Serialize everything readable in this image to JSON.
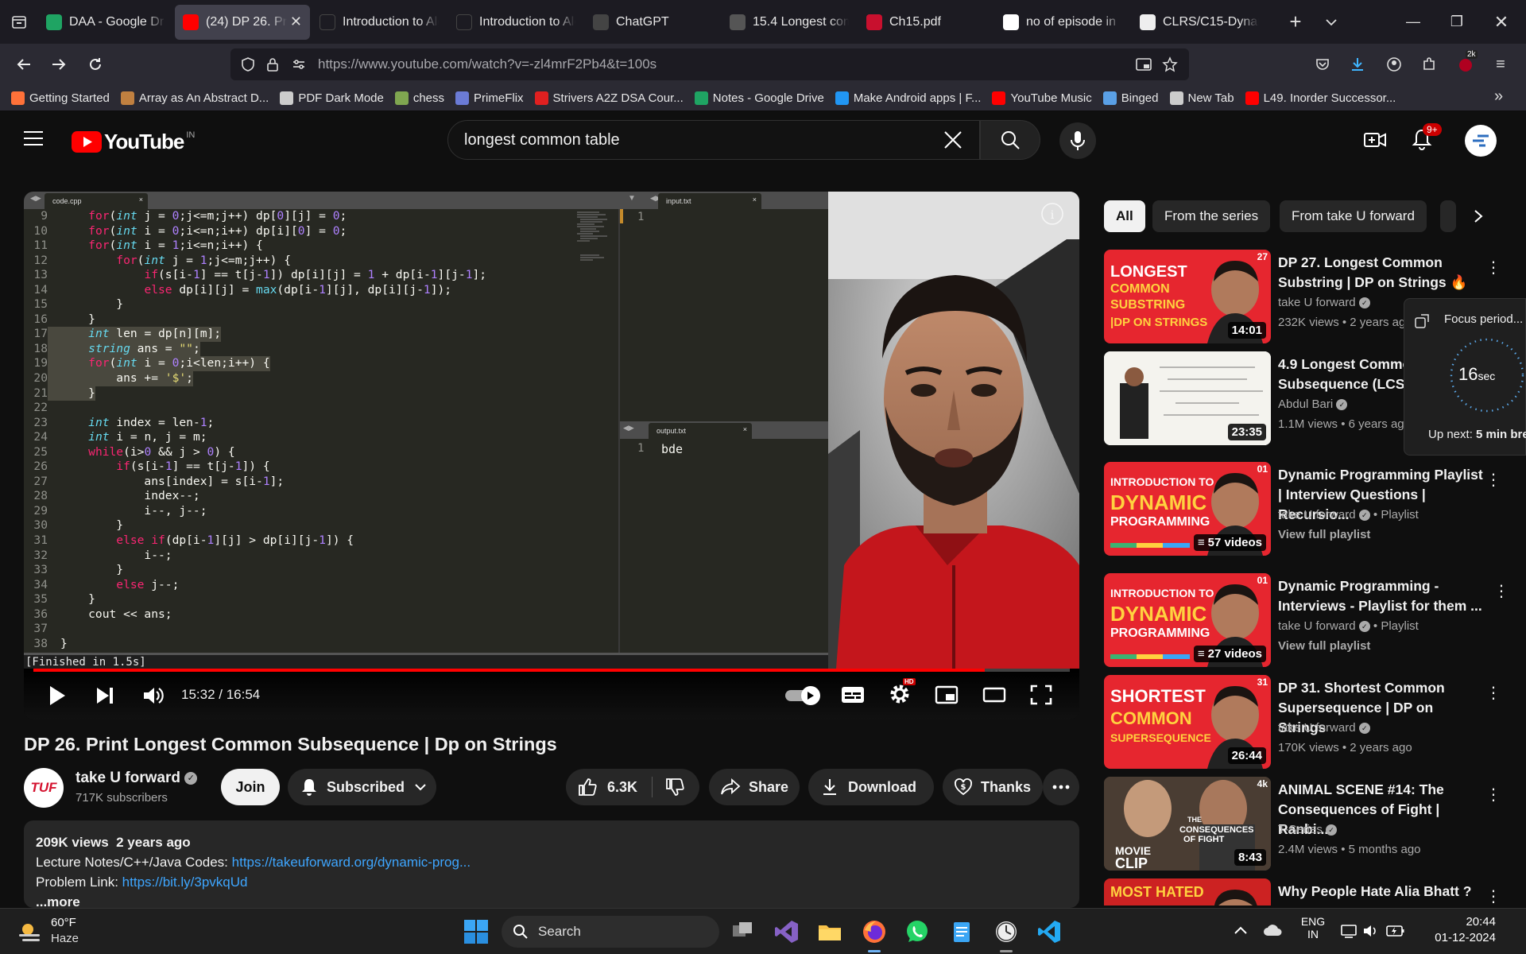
{
  "browser": {
    "tabs": [
      {
        "title": "DAA - Google Dr",
        "fav_color": "#1fa463"
      },
      {
        "title": "(24) DP 26. Print",
        "fav_color": "#ff0000",
        "active": true
      },
      {
        "title": "Introduction to Algor",
        "fav_color": "#1c1b22"
      },
      {
        "title": "Introduction to Algor",
        "fav_color": "#1c1b22"
      },
      {
        "title": "ChatGPT",
        "fav_color": "#444"
      },
      {
        "title": "15.4 Longest com",
        "fav_color": "#555"
      },
      {
        "title": "Ch15.pdf",
        "fav_color": "#c8102e"
      },
      {
        "title": "no of episode in",
        "fav_color": "#fff"
      },
      {
        "title": "CLRS/C15-Dynam",
        "fav_color": "#eee"
      }
    ],
    "url": "https://www.youtube.com/watch?v=-zl4mrF2Pb4&t=100s",
    "extension_badge": "2k",
    "bookmarks": [
      {
        "label": "Getting Started",
        "color": "#ff7139"
      },
      {
        "label": "Array as An Abstract D...",
        "color": "#c08040"
      },
      {
        "label": "PDF Dark Mode",
        "color": "#ccc"
      },
      {
        "label": "chess",
        "color": "#7fa650"
      },
      {
        "label": "PrimeFlix",
        "color": "#6b7bd6"
      },
      {
        "label": "Strivers A2Z DSA Cour...",
        "color": "#e02020"
      },
      {
        "label": "Notes - Google Drive",
        "color": "#1fa463"
      },
      {
        "label": "Make Android apps | F...",
        "color": "#2196f3"
      },
      {
        "label": "YouTube Music",
        "color": "#ff0000"
      },
      {
        "label": "Binged",
        "color": "#5aa0e6"
      },
      {
        "label": "New Tab",
        "color": "#ccc"
      },
      {
        "label": "L49. Inorder Successor...",
        "color": "#ff0000"
      }
    ]
  },
  "youtube": {
    "logo_text": "YouTube",
    "region": "IN",
    "search_value": "longest common table",
    "notification_count": "9+"
  },
  "player": {
    "editor_tabs": {
      "code": "code.cpp",
      "input": "input.txt",
      "output": "output.txt"
    },
    "input_line": "1",
    "output_line": "1",
    "output_text": "bde",
    "console_text": "[Finished in 1.5s]",
    "time": "15:32 / 16:54",
    "progress": 0.918,
    "code_start_line": 9,
    "code_lines": [
      "    for(int j = 0;j<=m;j++) dp[0][j] = 0;",
      "    for(int i = 0;i<=n;i++) dp[i][0] = 0;",
      "    for(int i = 1;i<=n;i++) {",
      "        for(int j = 1;j<=m;j++) {",
      "            if(s[i-1] == t[j-1]) dp[i][j] = 1 + dp[i-1][j-1];",
      "            else dp[i][j] = max(dp[i-1][j], dp[i][j-1]);",
      "        }",
      "    }",
      "    int len = dp[n][m];",
      "    string ans = \"\";",
      "    for(int i = 0;i<len;i++) {",
      "        ans += '$';",
      "    }",
      "",
      "    int index = len-1;",
      "    int i = n, j = m;",
      "    while(i>0 && j > 0) {",
      "        if(s[i-1] == t[j-1]) {",
      "            ans[index] = s[i-1];",
      "            index--;",
      "            i--, j--;",
      "        }",
      "        else if(dp[i-1][j] > dp[i][j-1]) {",
      "            i--;",
      "        }",
      "        else j--;",
      "    }",
      "    cout << ans;",
      "",
      "}"
    ]
  },
  "video": {
    "title": "DP 26. Print Longest Common Subsequence | Dp on Strings",
    "channel": "take U forward",
    "channel_avatar_text": "TUF",
    "subscribers": "717K subscribers",
    "join_label": "Join",
    "subscribed_label": "Subscribed",
    "likes": "6.3K",
    "share_label": "Share",
    "download_label": "Download",
    "thanks_label": "Thanks",
    "views_ago": "209K views  2 years ago",
    "desc_line1_label": "Lecture Notes/C++/Java Codes: ",
    "desc_line1_link": "https://takeuforward.org/dynamic-prog...",
    "desc_line2_label": "Problem Link: ",
    "desc_line2_link": "https://bit.ly/3pvkqUd",
    "more_label": "...more"
  },
  "chips": [
    "All",
    "From the series",
    "From take U forward"
  ],
  "recommendations": [
    {
      "title": "DP 27. Longest Common Substring | DP on Strings 🔥",
      "channel": "take U forward",
      "meta": "232K views  • 2 years ago",
      "duration": "14:01",
      "thumb_lines": [
        "LONGEST",
        "COMMON",
        "SUBSTRING",
        "|DP ON STRINGS"
      ],
      "thumb_num": "27"
    },
    {
      "title": "4.9 Longest Common Subsequence (LCS)",
      "channel": "Abdul Bari",
      "meta": "1.1M views  • 6 years ago",
      "duration": "23:35"
    },
    {
      "title": "Dynamic Programming Playlist | Interview Questions | Recursio...",
      "channel": "take U forward",
      "meta": "Playlist",
      "extra": "View full playlist",
      "duration": "57 videos",
      "thumb_lines": [
        "INTRODUCTION TO",
        "DYNAMIC",
        "PROGRAMMING"
      ],
      "thumb_num": "01"
    },
    {
      "title": "Dynamic Programming - Interviews - Playlist for them ...",
      "channel": "take U forward",
      "meta": "Playlist",
      "extra": "View full playlist",
      "duration": "27 videos",
      "thumb_lines": [
        "INTRODUCTION TO",
        "DYNAMIC",
        "PROGRAMMING"
      ],
      "thumb_num": "01"
    },
    {
      "title": "DP 31. Shortest Common Supersequence | DP on Strings",
      "channel": "take U forward",
      "meta": "170K views  • 2 years ago",
      "duration": "26:44",
      "thumb_lines": [
        "SHORTEST",
        "COMMON",
        "SUPERSEQUENCE"
      ],
      "thumb_num": "31"
    },
    {
      "title": "ANIMAL SCENE #14: The Consequences of Fight | Ranbi...",
      "channel": "T-Series",
      "meta": "2.4M views  • 5 months ago",
      "duration": "8:43",
      "thumb_lines": [
        "THE",
        "CONSEQUENCES",
        "OF FIGHT",
        "MOVIE",
        "CLIP"
      ],
      "thumb_num": "4k"
    },
    {
      "title": "Why People Hate Alia Bhatt ?",
      "thumb_lines": [
        "MOST HATED"
      ]
    }
  ],
  "focus_widget": {
    "title": "Focus period...",
    "seconds": "16",
    "unit": "sec",
    "upnext_label": "Up next:",
    "upnext_value": "5 min bre"
  },
  "taskbar": {
    "temp": "60°F",
    "weather": "Haze",
    "search_label": "Search",
    "lang1": "ENG",
    "lang2": "IN",
    "time": "20:44",
    "date": "01-12-2024"
  }
}
